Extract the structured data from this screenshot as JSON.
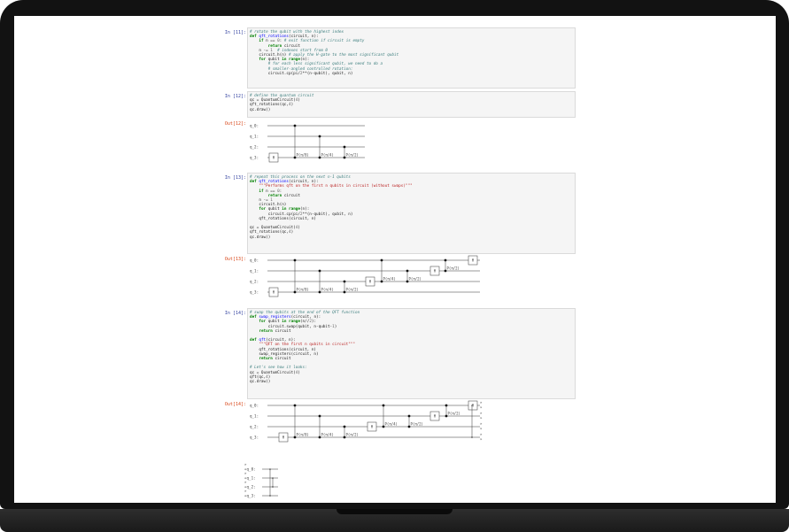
{
  "cells": [
    {
      "id": "cell-11",
      "prompt": "In [11]:",
      "lines": [
        [
          [
            "c",
            "# rotate the qubit with the highest index"
          ]
        ],
        [
          [
            "k",
            "def "
          ],
          [
            "f",
            "qft_rotations"
          ],
          [
            "",
            "(circuit, n):"
          ]
        ],
        [
          [
            "",
            "    "
          ],
          [
            "k",
            "if "
          ],
          [
            "",
            "n == "
          ],
          [
            "n",
            "0"
          ],
          [
            "",
            ": "
          ],
          [
            "c",
            "# exit function if circuit is empty"
          ]
        ],
        [
          [
            "",
            "        "
          ],
          [
            "k",
            "return "
          ],
          [
            "",
            "circuit"
          ]
        ],
        [
          [
            "",
            "    n -= "
          ],
          [
            "n",
            "1"
          ],
          [
            "",
            "  "
          ],
          [
            "c",
            "# indexes start from 0"
          ]
        ],
        [
          [
            "",
            "    circuit.h(n) "
          ],
          [
            "c",
            "# apply the H-gate to the most significant qubit"
          ]
        ],
        [
          [
            "",
            "    "
          ],
          [
            "k",
            "for "
          ],
          [
            "",
            "qubit "
          ],
          [
            "k",
            "in "
          ],
          [
            "k",
            "range"
          ],
          [
            "",
            "(n):"
          ]
        ],
        [
          [
            "",
            "        "
          ],
          [
            "c",
            "# for each less significant qubit, we need to do a"
          ]
        ],
        [
          [
            "",
            "        "
          ],
          [
            "c",
            "# smaller-angled controlled rotation:"
          ]
        ],
        [
          [
            "",
            "        circuit.cp(pi/"
          ],
          [
            "n",
            "2"
          ],
          [
            "",
            "**(n-qubit), qubit, n)"
          ]
        ]
      ]
    },
    {
      "id": "cell-12",
      "prompt": "In [12]:",
      "lines": [
        [
          [
            "c",
            "# define the quantum circuit"
          ]
        ],
        [
          [
            "",
            "qc = QuantumCircuit("
          ],
          [
            "n",
            "4"
          ],
          [
            "",
            ")"
          ]
        ],
        [
          [
            "",
            "qft_rotations(qc,"
          ],
          [
            "n",
            "4"
          ],
          [
            "",
            ")"
          ]
        ],
        [
          [
            "",
            "qc.draw()"
          ]
        ]
      ],
      "output": {
        "prompt": "Out[12]:",
        "wire_labels": [
          "q_0:",
          "q_1:",
          "q_2:",
          "q_3:"
        ],
        "gates": [
          "H",
          "P(π/8)",
          "P(π/4)",
          "P(π/2)"
        ]
      }
    },
    {
      "id": "cell-13",
      "prompt": "In [13]:",
      "lines": [
        [
          [
            "c",
            "# repeat this process on the next n-1 qubits"
          ]
        ],
        [
          [
            "k",
            "def "
          ],
          [
            "f",
            "qft_rotations"
          ],
          [
            "",
            "(circuit, n):"
          ]
        ],
        [
          [
            "",
            "    "
          ],
          [
            "s",
            "\"\"\"Performs qft on the first n qubits in circuit (without swaps)\"\"\""
          ]
        ],
        [
          [
            "",
            "    "
          ],
          [
            "k",
            "if "
          ],
          [
            "",
            "n == "
          ],
          [
            "n",
            "0"
          ],
          [
            "",
            ":"
          ]
        ],
        [
          [
            "",
            "        "
          ],
          [
            "k",
            "return "
          ],
          [
            "",
            "circuit"
          ]
        ],
        [
          [
            "",
            "    n -= "
          ],
          [
            "n",
            "1"
          ]
        ],
        [
          [
            "",
            "    circuit.h(n)"
          ]
        ],
        [
          [
            "",
            "    "
          ],
          [
            "k",
            "for "
          ],
          [
            "",
            "qubit "
          ],
          [
            "k",
            "in "
          ],
          [
            "k",
            "range"
          ],
          [
            "",
            "(n):"
          ]
        ],
        [
          [
            "",
            "        circuit.cp(pi/"
          ],
          [
            "n",
            "2"
          ],
          [
            "",
            "**(n-qubit), qubit, n)"
          ]
        ],
        [
          [
            "",
            "    qft_rotations(circuit, n)"
          ]
        ],
        [
          [
            "",
            ""
          ]
        ],
        [
          [
            "",
            "qc = QuantumCircuit("
          ],
          [
            "n",
            "4"
          ],
          [
            "",
            ")"
          ]
        ],
        [
          [
            "",
            "qft_rotations(qc,"
          ],
          [
            "n",
            "4"
          ],
          [
            "",
            ")"
          ]
        ],
        [
          [
            "",
            "qc.draw()"
          ]
        ]
      ],
      "output": {
        "prompt": "Out[13]:",
        "wire_labels": [
          "q_0:",
          "q_1:",
          "q_2:",
          "q_3:"
        ],
        "gates": [
          "H",
          "P(π/8)",
          "P(π/4)",
          "P(π/2)",
          "H",
          "P(π/4)",
          "P(π/2)",
          "H",
          "P(π/2)",
          "H"
        ]
      }
    },
    {
      "id": "cell-14",
      "prompt": "In [14]:",
      "lines": [
        [
          [
            "c",
            "# swap the qubits at the end of the QFT function"
          ]
        ],
        [
          [
            "k",
            "def "
          ],
          [
            "f",
            "swap_registers"
          ],
          [
            "",
            "(circuit, n):"
          ]
        ],
        [
          [
            "",
            "    "
          ],
          [
            "k",
            "for "
          ],
          [
            "",
            "qubit "
          ],
          [
            "k",
            "in "
          ],
          [
            "k",
            "range"
          ],
          [
            "",
            "(n//"
          ],
          [
            "n",
            "2"
          ],
          [
            "",
            "):"
          ]
        ],
        [
          [
            "",
            "        circuit.swap(qubit, n-qubit-"
          ],
          [
            "n",
            "1"
          ],
          [
            "",
            ")"
          ]
        ],
        [
          [
            "",
            "    "
          ],
          [
            "k",
            "return "
          ],
          [
            "",
            "circuit"
          ]
        ],
        [
          [
            "",
            ""
          ]
        ],
        [
          [
            "k",
            "def "
          ],
          [
            "f",
            "qft"
          ],
          [
            "",
            "(circuit, n):"
          ]
        ],
        [
          [
            "",
            "    "
          ],
          [
            "s",
            "\"\"\"QFT on the first n qubits in circuit\"\"\""
          ]
        ],
        [
          [
            "",
            "    qft_rotations(circuit, n)"
          ]
        ],
        [
          [
            "",
            "    swap_registers(circuit, n)"
          ]
        ],
        [
          [
            "",
            "    "
          ],
          [
            "k",
            "return "
          ],
          [
            "",
            "circuit"
          ]
        ],
        [
          [
            "",
            ""
          ]
        ],
        [
          [
            "c",
            "# Let's see how it looks:"
          ]
        ],
        [
          [
            "",
            "qc = QuantumCircuit("
          ],
          [
            "n",
            "4"
          ],
          [
            "",
            ")"
          ]
        ],
        [
          [
            "",
            "qft(qc,"
          ],
          [
            "n",
            "4"
          ],
          [
            "",
            ")"
          ]
        ],
        [
          [
            "",
            "qc.draw()"
          ]
        ]
      ],
      "output": {
        "prompt": "Out[14]:",
        "wire_labels": [
          "q_0:",
          "q_1:",
          "q_2:",
          "q_3:"
        ],
        "gates": [
          "H",
          "P(π/8)",
          "P(π/4)",
          "P(π/2)",
          "H",
          "P(π/4)",
          "P(π/2)",
          "H",
          "P(π/2)",
          "H"
        ],
        "swap_labels": [
          "«q_0:",
          "«q_1:",
          "«q_2:",
          "«q_3:"
        ]
      }
    }
  ]
}
